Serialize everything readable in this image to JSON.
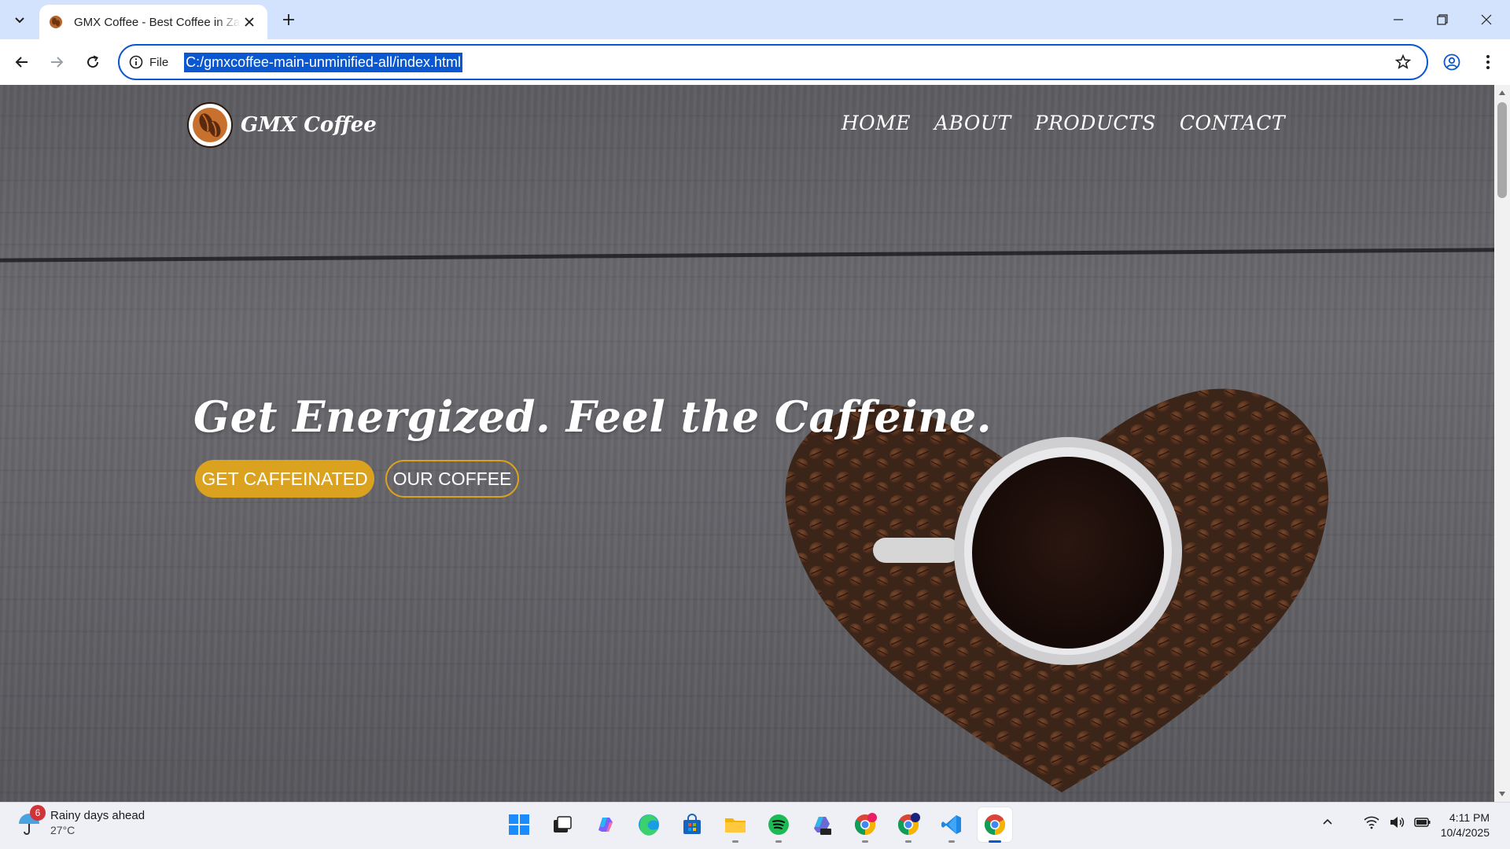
{
  "browser": {
    "tab": {
      "title": "GMX Coffee - Best Coffee in Zamboanga"
    },
    "omnibox": {
      "info_label": "File",
      "url": "C:/gmxcoffee-main-unminified-all/index.html"
    },
    "icons": [
      "tab-search-icon",
      "coffee-favicon",
      "close-icon",
      "plus-icon",
      "minimize-icon",
      "restore-icon",
      "close-window-icon",
      "back-arrow-icon",
      "forward-arrow-icon",
      "reload-icon",
      "info-icon",
      "star-icon",
      "profile-icon",
      "more-vert-icon"
    ]
  },
  "site": {
    "brand_name": "GMX Coffee",
    "menu": [
      "HOME",
      "ABOUT",
      "PRODUCTS",
      "CONTACT"
    ],
    "hero_title": "Get Energized. Feel the Caffeine.",
    "cta_primary": "GET CAFFEINATED",
    "cta_secondary": "OUR COFFEE"
  },
  "taskbar": {
    "weather": {
      "badge": "6",
      "headline": "Rainy days ahead",
      "temp": "27°C"
    },
    "apps": [
      "start",
      "task-view",
      "copilot",
      "edge",
      "store",
      "file-explorer",
      "spotify",
      "m365",
      "chrome-profile-l",
      "chrome-profile-2",
      "vscode",
      "chrome"
    ],
    "clock": {
      "time": "4:11 PM",
      "date": "10/4/2025"
    }
  },
  "colors": {
    "accent": "#0b57d0",
    "cta": "#daa21e",
    "tabstrip": "#d3e3fd"
  }
}
